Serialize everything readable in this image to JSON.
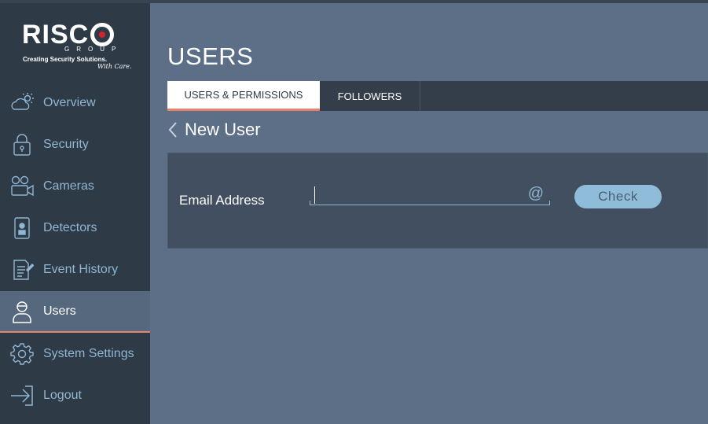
{
  "brand": {
    "name": "RISCO",
    "group": "GROUP",
    "tagline": "Creating Security Solutions.",
    "tagline_suffix": "With Care."
  },
  "sidebar": {
    "items": [
      {
        "label": "Overview",
        "icon": "cloud-sun-icon"
      },
      {
        "label": "Security",
        "icon": "lock-icon"
      },
      {
        "label": "Cameras",
        "icon": "camera-icon"
      },
      {
        "label": "Detectors",
        "icon": "detector-icon"
      },
      {
        "label": "Event History",
        "icon": "document-edit-icon"
      },
      {
        "label": "Users",
        "icon": "user-icon",
        "active": true
      },
      {
        "label": "System Settings",
        "icon": "gear-icon"
      },
      {
        "label": "Logout",
        "icon": "logout-icon"
      }
    ]
  },
  "main": {
    "title": "USERS",
    "tabs": [
      {
        "label": "USERS & PERMISSIONS",
        "active": true
      },
      {
        "label": "FOLLOWERS"
      }
    ],
    "back_title": "New User",
    "form": {
      "email_label": "Email Address",
      "email_value": "",
      "email_placeholder": "",
      "at_symbol": "@",
      "check_label": "Check"
    }
  },
  "colors": {
    "sidebar_bg": "#2f3a47",
    "main_bg": "#5c6f86",
    "accent": "#e8826a",
    "link_blue": "#8fb6d2",
    "panel_bg": "#424f61"
  }
}
